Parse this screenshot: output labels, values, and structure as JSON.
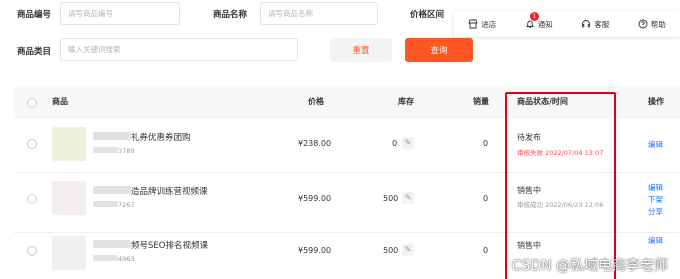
{
  "filters": {
    "product_code_label": "商品编号",
    "product_code_placeholder": "请写商品编号",
    "product_name_label": "商品名称",
    "product_name_placeholder": "请写商品名称",
    "price_range_label": "价格区间",
    "category_label": "商品类目",
    "category_placeholder": "输入关键词搜索",
    "reset_label": "重置",
    "query_label": "查询"
  },
  "toolbar": {
    "shop_label": "进店",
    "notify_label": "通知",
    "notify_badge": "1",
    "service_label": "客服",
    "help_label": "帮助"
  },
  "table": {
    "headers": {
      "product": "商品",
      "price": "价格",
      "stock": "库存",
      "sales": "销量",
      "status_time": "商品状态/时间",
      "operation": "操作"
    },
    "rows": [
      {
        "name": "礼券优惠券团购",
        "id_suffix": "3789",
        "price": "¥238.00",
        "stock": "0",
        "sales": "0",
        "status": "待发布",
        "status_detail": "审核失败 2022/07/04 13:07",
        "status_detail_type": "fail",
        "ops": [
          "编辑"
        ]
      },
      {
        "name": "造品牌训练营视频课",
        "id_suffix": "7267",
        "price": "¥599.00",
        "stock": "500",
        "sales": "0",
        "status": "销售中",
        "status_detail": "审核成功 2022/06/23 12:06",
        "status_detail_type": "ok",
        "ops": [
          "编辑",
          "下架",
          "分享"
        ]
      },
      {
        "name": "频号SEO排名视频课",
        "id_suffix": "4963",
        "price": "¥599.00",
        "stock": "500",
        "sales": "0",
        "status": "销售中",
        "status_detail": "",
        "status_detail_type": "ok",
        "ops": [
          "编辑"
        ]
      }
    ],
    "edit_icon_glyph": "✎"
  },
  "watermark": "CSDN @私域电商李老师",
  "colors": {
    "accent": "#ff5722",
    "link": "#1677ff",
    "fail": "#ff4d4f",
    "highlight": "#d9001b",
    "badge": "#f5222d"
  }
}
